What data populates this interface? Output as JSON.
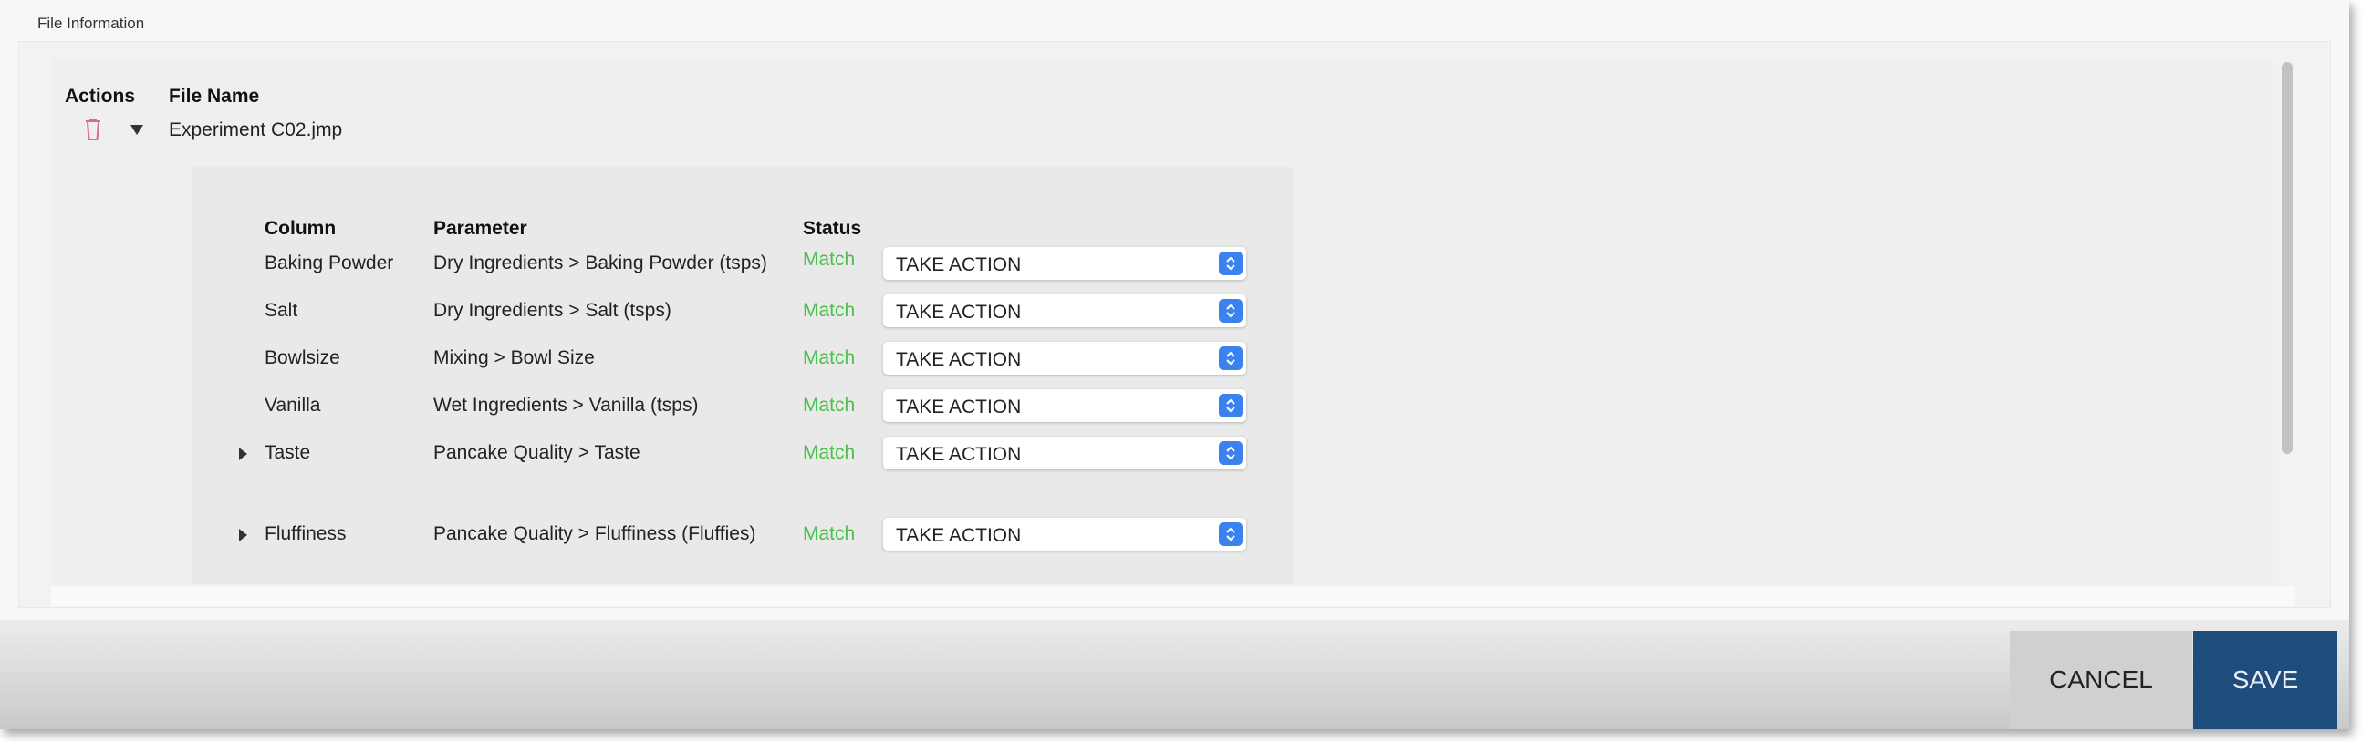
{
  "section": {
    "title": "File Information"
  },
  "file_table": {
    "headers": {
      "actions": "Actions",
      "file_name": "File Name"
    },
    "files": [
      {
        "name": "Experiment C02.jmp",
        "expanded": true
      }
    ]
  },
  "mapping_table": {
    "headers": {
      "column": "Column",
      "parameter": "Parameter",
      "status": "Status"
    },
    "rows": [
      {
        "column": "Baking Powder",
        "parameter": "Dry Ingredients > Baking Powder (tsps)",
        "status": "Match",
        "action": "TAKE ACTION",
        "expandable": false
      },
      {
        "column": "Salt",
        "parameter": "Dry Ingredients > Salt (tsps)",
        "status": "Match",
        "action": "TAKE ACTION",
        "expandable": false
      },
      {
        "column": "Bowlsize",
        "parameter": "Mixing > Bowl Size",
        "status": "Match",
        "action": "TAKE ACTION",
        "expandable": false
      },
      {
        "column": "Vanilla",
        "parameter": "Wet Ingredients > Vanilla (tsps)",
        "status": "Match",
        "action": "TAKE ACTION",
        "expandable": false
      },
      {
        "column": "Taste",
        "parameter": "Pancake Quality > Taste",
        "status": "Match",
        "action": "TAKE ACTION",
        "expandable": true
      },
      {
        "column": "Fluffiness",
        "parameter": "Pancake Quality > Fluffiness (Fluffies)",
        "status": "Match",
        "action": "TAKE ACTION",
        "expandable": true
      }
    ]
  },
  "footer": {
    "cancel_label": "CANCEL",
    "save_label": "SAVE"
  },
  "colors": {
    "status_match": "#4cbf4c",
    "save_button": "#1e4d7c",
    "select_accent": "#3b82f0",
    "delete_icon": "#e0679a"
  }
}
